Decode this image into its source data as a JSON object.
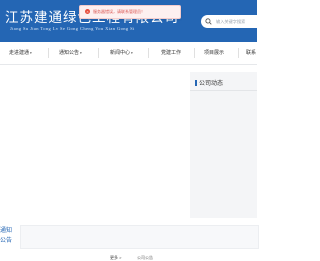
{
  "header": {
    "company_name": "江苏建通绿色工程有限公司",
    "company_pinyin": "Jiang Su Jian Tong Lv Se Gong Cheng You Xian Gong Si",
    "search_placeholder": "输入关键字搜索",
    "search_icon": "search-icon"
  },
  "alert": {
    "icon": "error-icon",
    "text": "服务器错误，请联系管理员！",
    "color": "#d9534f"
  },
  "nav": {
    "items": [
      {
        "label": "走进建通",
        "dropdown": true
      },
      {
        "label": "通知公告",
        "dropdown": true
      },
      {
        "label": "新闻中心",
        "dropdown": true
      },
      {
        "label": "党建工作",
        "dropdown": false
      },
      {
        "label": "项目展示",
        "dropdown": false
      },
      {
        "label": "联系",
        "dropdown": false
      }
    ],
    "caret": "▾"
  },
  "sidebar": {
    "title": "公司动态"
  },
  "notice": {
    "label": "通知公告"
  },
  "footer": {
    "left": "更多 >",
    "right": "公司公告"
  },
  "colors": {
    "brand": "#2466b4",
    "header_text": "#ffffff"
  }
}
